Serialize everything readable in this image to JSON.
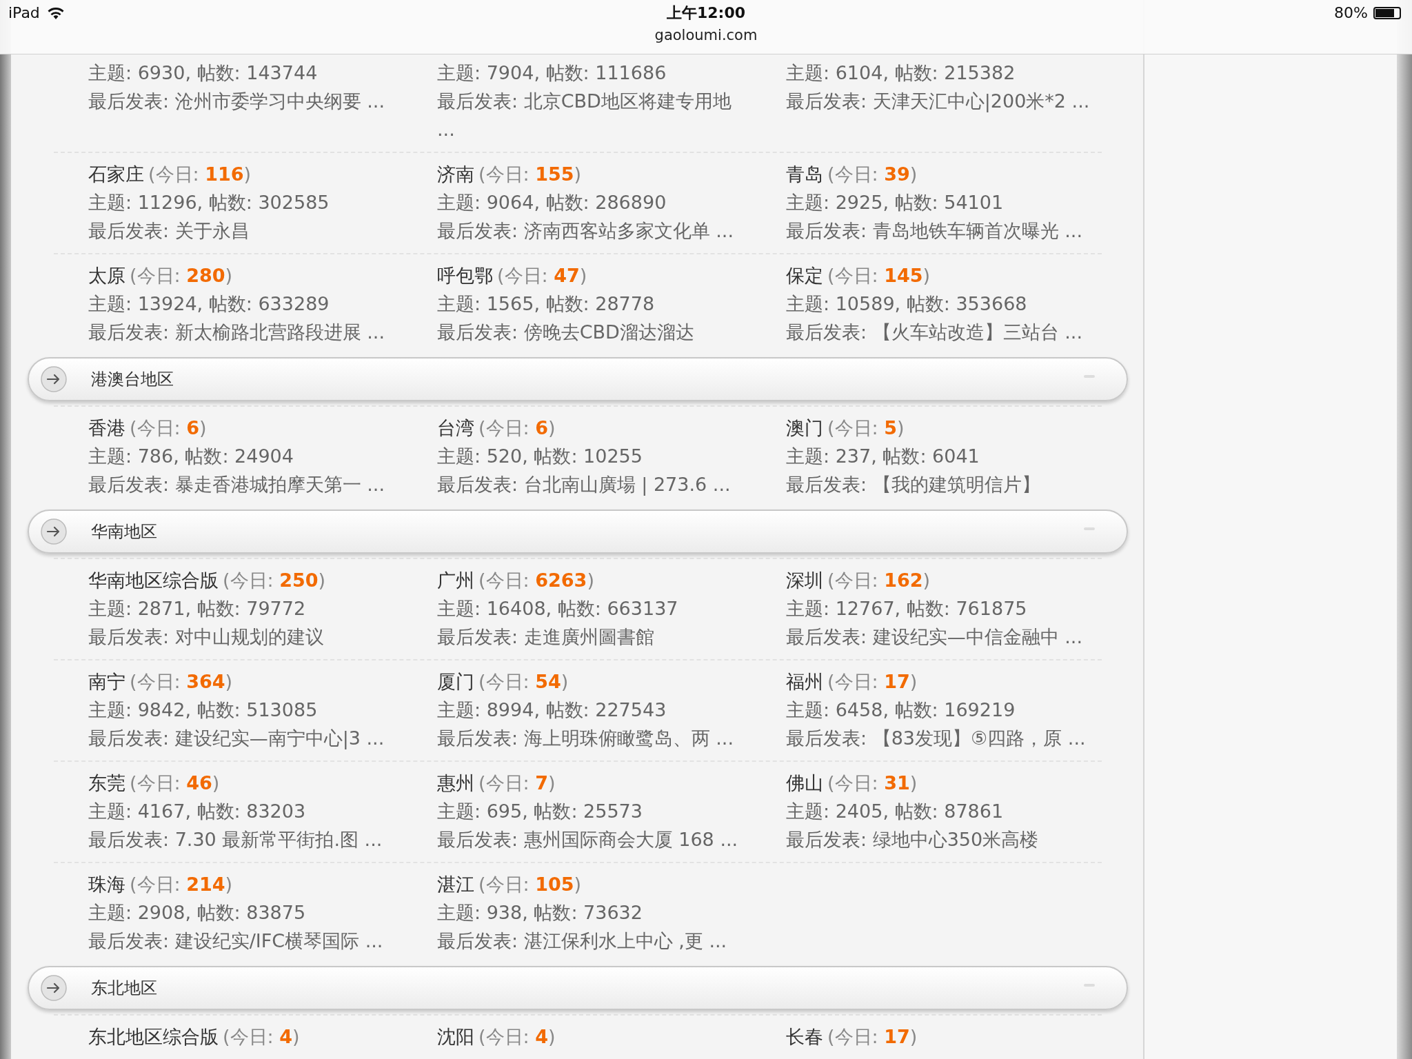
{
  "status_bar": {
    "device": "iPad",
    "time": "上午12:00",
    "url": "gaoloumi.com",
    "battery": "80%"
  },
  "sections": [
    {
      "forums": [
        {
          "stats": "主题: 6930, 帖数: 143744",
          "last": "最后发表: 沧州市委学习中央纲要 ..."
        },
        {
          "stats": "主题: 7904, 帖数: 111686",
          "last": "最后发表: 北京CBD地区将建专用地 ..."
        },
        {
          "stats": "主题: 6104, 帖数: 215382",
          "last": "最后发表: 天津天汇中心|200米*2 ..."
        },
        {
          "name": "石家庄",
          "count": "(今日: **116**)",
          "stats": "主题: 11296, 帖数: 302585",
          "last": "最后发表: 关于永昌"
        },
        {
          "name": "济南",
          "count": "(今日: **155**)",
          "stats": "主题: 9064, 帖数: 286890",
          "last": "最后发表: 济南西客站多家文化单 ..."
        },
        {
          "name": "青岛",
          "count": "(今日: **39**)",
          "stats": "主题: 2925, 帖数: 54101",
          "last": "最后发表: 青岛地铁车辆首次曝光 ..."
        },
        {
          "name": "太原",
          "count": "(今日: **280**)",
          "stats": "主题: 13924, 帖数: 633289",
          "last": "最后发表: 新太榆路北营路段进展 ..."
        },
        {
          "name": "呼包鄂",
          "count": "(今日: **47**)",
          "stats": "主题: 1565, 帖数: 28778",
          "last": "最后发表: 傍晚去CBD溜达溜达"
        },
        {
          "name": "保定",
          "count": "(今日: **145**)",
          "stats": "主题: 10589, 帖数: 353668",
          "last": "最后发表: 【火车站改造】三站台 ..."
        }
      ]
    },
    {
      "title": "港澳台地区",
      "forums": [
        {
          "name": "香港",
          "count": "(今日: **6**)",
          "stats": "主题: 786, 帖数: 24904",
          "last": "最后发表: 暴走香港城拍摩天第一 ..."
        },
        {
          "name": "台湾",
          "count": "(今日: **6**)",
          "stats": "主题: 520, 帖数: 10255",
          "last": "最后发表: 台北南山廣場 | 273.6 ..."
        },
        {
          "name": "澳门",
          "count": "(今日: **5**)",
          "stats": "主题: 237, 帖数: 6041",
          "last": "最后发表: 【我的建筑明信片】"
        }
      ]
    },
    {
      "title": "华南地区",
      "forums": [
        {
          "name": "华南地区综合版",
          "count": "(今日: **250**)",
          "stats": "主题: 2871, 帖数: 79772",
          "last": "最后发表: 对中山规划的建议"
        },
        {
          "name": "广州",
          "count": "(今日: **6263**)",
          "stats": "主题: 16408, 帖数: 663137",
          "last": "最后发表: 走進廣州圖書館"
        },
        {
          "name": "深圳",
          "count": "(今日: **162**)",
          "stats": "主题: 12767, 帖数: 761875",
          "last": "最后发表: 建设纪实—中信金融中 ..."
        },
        {
          "name": "南宁",
          "count": "(今日: **364**)",
          "stats": "主题: 9842, 帖数: 513085",
          "last": "最后发表: 建设纪实—南宁中心|3 ..."
        },
        {
          "name": "厦门",
          "count": "(今日: **54**)",
          "stats": "主题: 8994, 帖数: 227543",
          "last": "最后发表: 海上明珠俯瞰鹭岛、两 ..."
        },
        {
          "name": "福州",
          "count": "(今日: **17**)",
          "stats": "主题: 6458, 帖数: 169219",
          "last": "最后发表: 【83发现】⑤四路，原 ..."
        },
        {
          "name": "东莞",
          "count": "(今日: **46**)",
          "stats": "主题: 4167, 帖数: 83203",
          "last": "最后发表: 7.30 最新常平街拍.图 ..."
        },
        {
          "name": "惠州",
          "count": "(今日: **7**)",
          "stats": "主题: 695, 帖数: 25573",
          "last": "最后发表: 惠州国际商会大厦 168 ..."
        },
        {
          "name": "佛山",
          "count": "(今日: **31**)",
          "stats": "主题: 2405, 帖数: 87861",
          "last": "最后发表: 绿地中心350米高楼"
        },
        {
          "name": "珠海",
          "count": "(今日: **214**)",
          "stats": "主题: 2908, 帖数: 83875",
          "last": "最后发表: 建设纪实/IFC横琴国际 ..."
        },
        {
          "name": "湛江",
          "count": "(今日: **105**)",
          "stats": "主题: 938, 帖数: 73632",
          "last": "最后发表: 湛江保利水上中心 ,更 ..."
        }
      ]
    },
    {
      "title": "东北地区",
      "forums": [
        {
          "name": "东北地区综合版",
          "count": "(今日: **4**)"
        },
        {
          "name": "沈阳",
          "count": "(今日: **4**)"
        },
        {
          "name": "长春",
          "count": "(今日: **17**)"
        }
      ]
    }
  ]
}
